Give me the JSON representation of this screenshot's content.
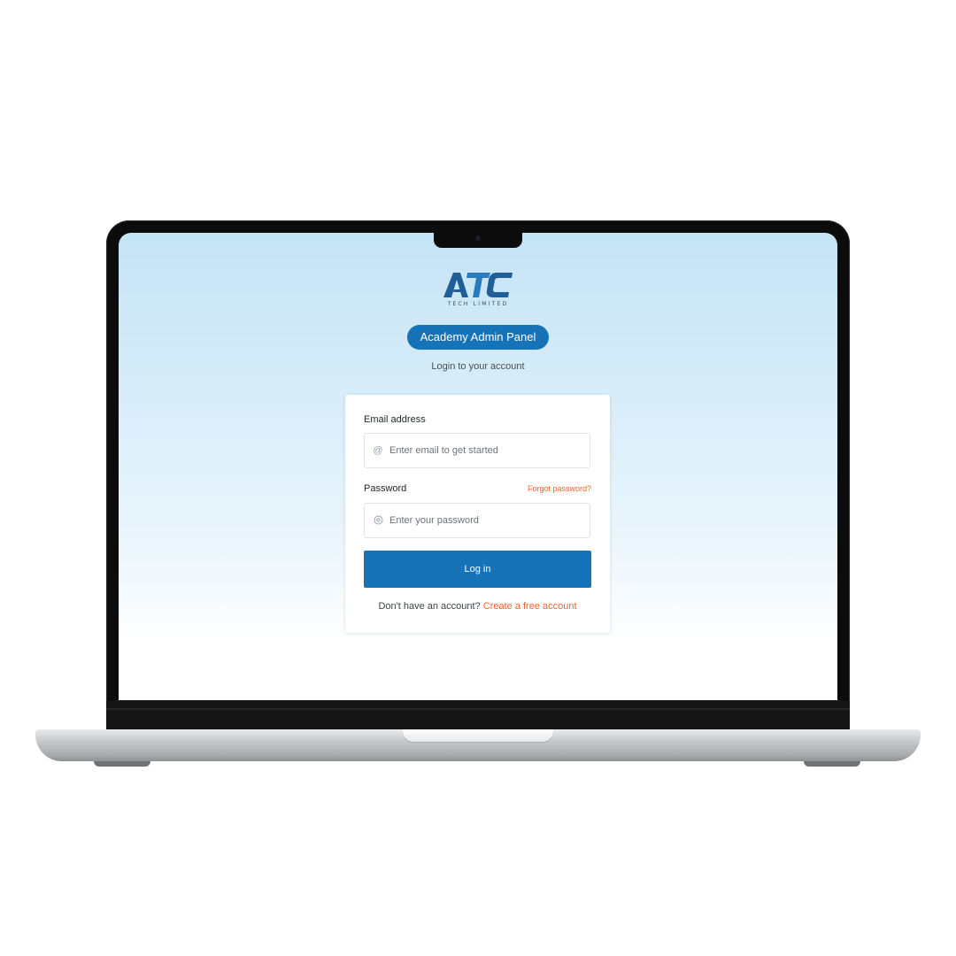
{
  "brand": {
    "logo_text": "ATC",
    "logo_subtext": "TECH LIMITED",
    "colors": {
      "primary": "#1673b8",
      "accent": "#f0642d"
    }
  },
  "header": {
    "panel_title": "Academy Admin Panel",
    "subtitle": "Login to your account"
  },
  "form": {
    "email": {
      "label": "Email address",
      "icon": "at-icon",
      "placeholder": "Enter email to get started",
      "value": ""
    },
    "password": {
      "label": "Password",
      "icon": "lock-icon",
      "placeholder": "Enter your password",
      "value": "",
      "forgot_link": "Forgot password?"
    },
    "submit_label": "Log in",
    "signup_prompt": "Don't have an account?",
    "signup_link": "Create a free account"
  }
}
